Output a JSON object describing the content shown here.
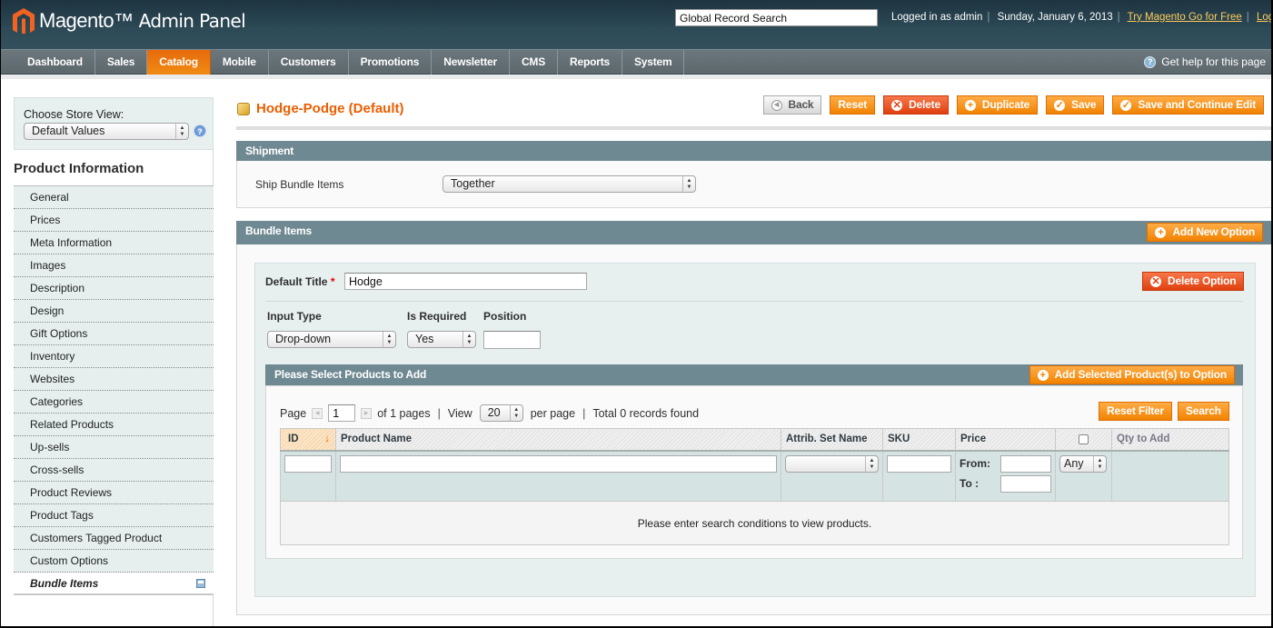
{
  "header": {
    "logo_brand": "Magento",
    "logo_sub": "Admin Panel",
    "search_value": "Global Record Search",
    "logged_in": "Logged in as admin",
    "date": "Sunday, January 6, 2013",
    "try_link": "Try Magento Go for Free",
    "logout": "Log Out"
  },
  "nav": {
    "items": [
      "Dashboard",
      "Sales",
      "Catalog",
      "Mobile",
      "Customers",
      "Promotions",
      "Newsletter",
      "CMS",
      "Reports",
      "System"
    ],
    "active": "Catalog",
    "help": "Get help for this page"
  },
  "sidebar": {
    "store_label": "Choose Store View:",
    "store_value": "Default Values",
    "section_title": "Product Information",
    "tabs": [
      "General",
      "Prices",
      "Meta Information",
      "Images",
      "Description",
      "Design",
      "Gift Options",
      "Inventory",
      "Websites",
      "Categories",
      "Related Products",
      "Up-sells",
      "Cross-sells",
      "Product Reviews",
      "Product Tags",
      "Customers Tagged Product",
      "Custom Options",
      "Bundle Items"
    ],
    "active_tab": "Bundle Items"
  },
  "page": {
    "title": "Hodge-Podge (Default)",
    "buttons": {
      "back": "Back",
      "reset": "Reset",
      "delete": "Delete",
      "duplicate": "Duplicate",
      "save": "Save",
      "save_continue": "Save and Continue Edit"
    }
  },
  "shipment": {
    "header": "Shipment",
    "label": "Ship Bundle Items",
    "value": "Together"
  },
  "bundle": {
    "header": "Bundle Items",
    "add_option": "Add New Option",
    "default_title_label": "Default Title",
    "required_mark": "*",
    "default_title_value": "Hodge",
    "delete_option": "Delete Option",
    "input_type_label": "Input Type",
    "input_type_value": "Drop-down",
    "is_required_label": "Is Required",
    "is_required_value": "Yes",
    "position_label": "Position",
    "position_value": ""
  },
  "products": {
    "header": "Please Select Products to Add",
    "add_selected": "Add Selected Product(s) to Option",
    "pager": {
      "page_label": "Page",
      "page_value": "1",
      "of_pages": "of 1 pages",
      "view_label": "View",
      "view_value": "20",
      "per_page": "per page",
      "total": "Total 0 records found"
    },
    "reset_filter": "Reset Filter",
    "search": "Search",
    "columns": [
      "ID",
      "Product Name",
      "Attrib. Set Name",
      "SKU",
      "Price",
      "",
      "Qty to Add"
    ],
    "price_from": "From:",
    "price_to": "To :",
    "any_value": "Any",
    "empty_message": "Please enter search conditions to view products."
  }
}
